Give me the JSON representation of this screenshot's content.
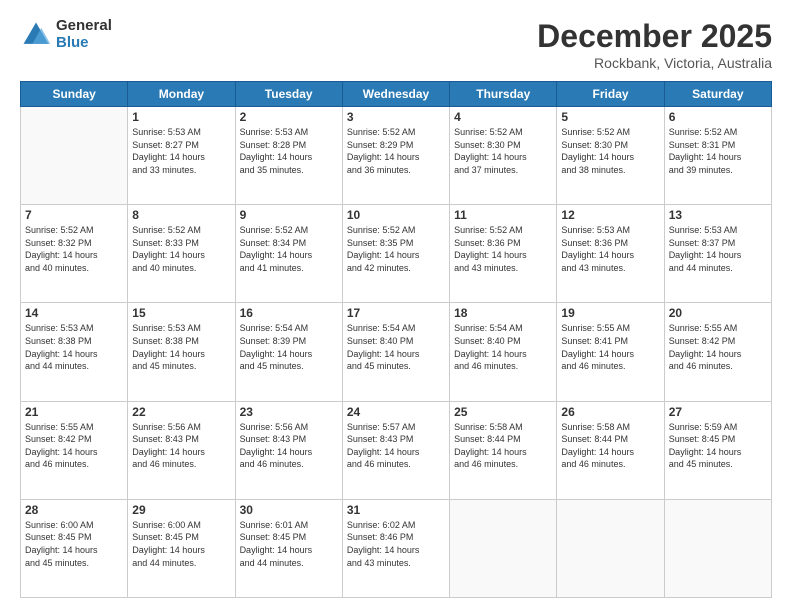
{
  "header": {
    "logo_general": "General",
    "logo_blue": "Blue",
    "month_title": "December 2025",
    "location": "Rockbank, Victoria, Australia"
  },
  "days_of_week": [
    "Sunday",
    "Monday",
    "Tuesday",
    "Wednesday",
    "Thursday",
    "Friday",
    "Saturday"
  ],
  "weeks": [
    [
      {
        "day": "",
        "info": ""
      },
      {
        "day": "1",
        "info": "Sunrise: 5:53 AM\nSunset: 8:27 PM\nDaylight: 14 hours\nand 33 minutes."
      },
      {
        "day": "2",
        "info": "Sunrise: 5:53 AM\nSunset: 8:28 PM\nDaylight: 14 hours\nand 35 minutes."
      },
      {
        "day": "3",
        "info": "Sunrise: 5:52 AM\nSunset: 8:29 PM\nDaylight: 14 hours\nand 36 minutes."
      },
      {
        "day": "4",
        "info": "Sunrise: 5:52 AM\nSunset: 8:30 PM\nDaylight: 14 hours\nand 37 minutes."
      },
      {
        "day": "5",
        "info": "Sunrise: 5:52 AM\nSunset: 8:30 PM\nDaylight: 14 hours\nand 38 minutes."
      },
      {
        "day": "6",
        "info": "Sunrise: 5:52 AM\nSunset: 8:31 PM\nDaylight: 14 hours\nand 39 minutes."
      }
    ],
    [
      {
        "day": "7",
        "info": "Sunrise: 5:52 AM\nSunset: 8:32 PM\nDaylight: 14 hours\nand 40 minutes."
      },
      {
        "day": "8",
        "info": "Sunrise: 5:52 AM\nSunset: 8:33 PM\nDaylight: 14 hours\nand 40 minutes."
      },
      {
        "day": "9",
        "info": "Sunrise: 5:52 AM\nSunset: 8:34 PM\nDaylight: 14 hours\nand 41 minutes."
      },
      {
        "day": "10",
        "info": "Sunrise: 5:52 AM\nSunset: 8:35 PM\nDaylight: 14 hours\nand 42 minutes."
      },
      {
        "day": "11",
        "info": "Sunrise: 5:52 AM\nSunset: 8:36 PM\nDaylight: 14 hours\nand 43 minutes."
      },
      {
        "day": "12",
        "info": "Sunrise: 5:53 AM\nSunset: 8:36 PM\nDaylight: 14 hours\nand 43 minutes."
      },
      {
        "day": "13",
        "info": "Sunrise: 5:53 AM\nSunset: 8:37 PM\nDaylight: 14 hours\nand 44 minutes."
      }
    ],
    [
      {
        "day": "14",
        "info": "Sunrise: 5:53 AM\nSunset: 8:38 PM\nDaylight: 14 hours\nand 44 minutes."
      },
      {
        "day": "15",
        "info": "Sunrise: 5:53 AM\nSunset: 8:38 PM\nDaylight: 14 hours\nand 45 minutes."
      },
      {
        "day": "16",
        "info": "Sunrise: 5:54 AM\nSunset: 8:39 PM\nDaylight: 14 hours\nand 45 minutes."
      },
      {
        "day": "17",
        "info": "Sunrise: 5:54 AM\nSunset: 8:40 PM\nDaylight: 14 hours\nand 45 minutes."
      },
      {
        "day": "18",
        "info": "Sunrise: 5:54 AM\nSunset: 8:40 PM\nDaylight: 14 hours\nand 46 minutes."
      },
      {
        "day": "19",
        "info": "Sunrise: 5:55 AM\nSunset: 8:41 PM\nDaylight: 14 hours\nand 46 minutes."
      },
      {
        "day": "20",
        "info": "Sunrise: 5:55 AM\nSunset: 8:42 PM\nDaylight: 14 hours\nand 46 minutes."
      }
    ],
    [
      {
        "day": "21",
        "info": "Sunrise: 5:55 AM\nSunset: 8:42 PM\nDaylight: 14 hours\nand 46 minutes."
      },
      {
        "day": "22",
        "info": "Sunrise: 5:56 AM\nSunset: 8:43 PM\nDaylight: 14 hours\nand 46 minutes."
      },
      {
        "day": "23",
        "info": "Sunrise: 5:56 AM\nSunset: 8:43 PM\nDaylight: 14 hours\nand 46 minutes."
      },
      {
        "day": "24",
        "info": "Sunrise: 5:57 AM\nSunset: 8:43 PM\nDaylight: 14 hours\nand 46 minutes."
      },
      {
        "day": "25",
        "info": "Sunrise: 5:58 AM\nSunset: 8:44 PM\nDaylight: 14 hours\nand 46 minutes."
      },
      {
        "day": "26",
        "info": "Sunrise: 5:58 AM\nSunset: 8:44 PM\nDaylight: 14 hours\nand 46 minutes."
      },
      {
        "day": "27",
        "info": "Sunrise: 5:59 AM\nSunset: 8:45 PM\nDaylight: 14 hours\nand 45 minutes."
      }
    ],
    [
      {
        "day": "28",
        "info": "Sunrise: 6:00 AM\nSunset: 8:45 PM\nDaylight: 14 hours\nand 45 minutes."
      },
      {
        "day": "29",
        "info": "Sunrise: 6:00 AM\nSunset: 8:45 PM\nDaylight: 14 hours\nand 44 minutes."
      },
      {
        "day": "30",
        "info": "Sunrise: 6:01 AM\nSunset: 8:45 PM\nDaylight: 14 hours\nand 44 minutes."
      },
      {
        "day": "31",
        "info": "Sunrise: 6:02 AM\nSunset: 8:46 PM\nDaylight: 14 hours\nand 43 minutes."
      },
      {
        "day": "",
        "info": ""
      },
      {
        "day": "",
        "info": ""
      },
      {
        "day": "",
        "info": ""
      }
    ]
  ]
}
